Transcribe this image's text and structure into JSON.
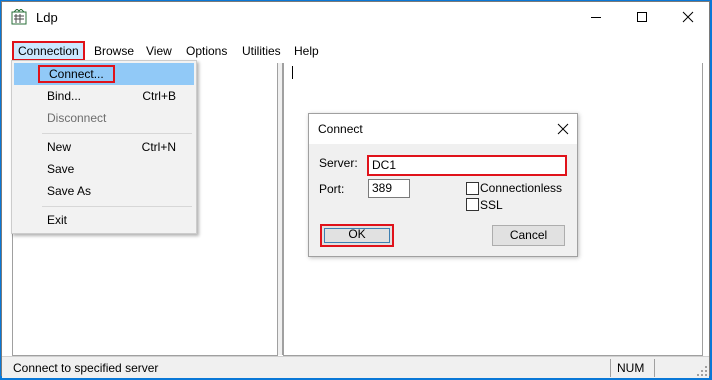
{
  "window": {
    "title": "Ldp"
  },
  "menubar": {
    "items": [
      "Connection",
      "Browse",
      "View",
      "Options",
      "Utilities",
      "Help"
    ]
  },
  "connection_menu": {
    "items": [
      {
        "label": "Connect...",
        "shortcut": ""
      },
      {
        "label": "Bind...",
        "shortcut": "Ctrl+B"
      },
      {
        "label": "Disconnect",
        "shortcut": ""
      },
      {
        "label": "New",
        "shortcut": "Ctrl+N"
      },
      {
        "label": "Save",
        "shortcut": ""
      },
      {
        "label": "Save As",
        "shortcut": ""
      },
      {
        "label": "Exit",
        "shortcut": ""
      }
    ]
  },
  "dialog": {
    "title": "Connect",
    "server_label": "Server:",
    "server_value": "DC1",
    "port_label": "Port:",
    "port_value": "389",
    "connectionless_label": "Connectionless",
    "ssl_label": "SSL",
    "ok_label": "OK",
    "cancel_label": "Cancel"
  },
  "statusbar": {
    "text": "Connect to specified server",
    "num": "NUM"
  },
  "colors": {
    "desktop": "#0a78d7",
    "highlight_border": "#e0121a",
    "menu_highlight": "#91c9f7"
  }
}
